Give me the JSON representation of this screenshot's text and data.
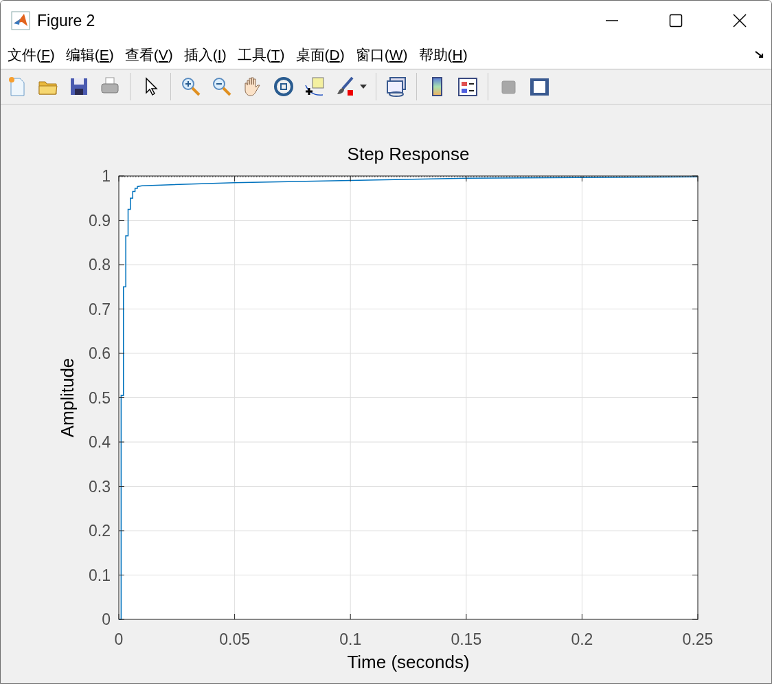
{
  "window": {
    "title": "Figure 2"
  },
  "menu": [
    {
      "before": "文件(",
      "key": "F",
      "after": ")"
    },
    {
      "before": "编辑(",
      "key": "E",
      "after": ")"
    },
    {
      "before": "查看(",
      "key": "V",
      "after": ")"
    },
    {
      "before": "插入(",
      "key": "I",
      "after": ")"
    },
    {
      "before": "工具(",
      "key": "T",
      "after": ")"
    },
    {
      "before": "桌面(",
      "key": "D",
      "after": ")"
    },
    {
      "before": "窗口(",
      "key": "W",
      "after": ")"
    },
    {
      "before": "帮助(",
      "key": "H",
      "after": ")"
    }
  ],
  "figure": {
    "chart_data": {
      "type": "line",
      "title": "Step Response",
      "xlabel": "Time (seconds)",
      "ylabel": "Amplitude",
      "xlim": [
        0,
        0.25
      ],
      "ylim": [
        0,
        1
      ],
      "xticks": [
        0,
        0.05,
        0.1,
        0.15,
        0.2,
        0.25
      ],
      "yticks": [
        0,
        0.1,
        0.2,
        0.3,
        0.4,
        0.5,
        0.6,
        0.7,
        0.8,
        0.9,
        1
      ],
      "grid": true,
      "x": [
        0,
        0.001,
        0.001,
        0.002,
        0.002,
        0.003,
        0.003,
        0.004,
        0.004,
        0.005,
        0.005,
        0.006,
        0.006,
        0.007,
        0.007,
        0.008,
        0.008,
        0.01,
        0.05,
        0.1,
        0.15,
        0.25
      ],
      "series": [
        {
          "color": "#0072bd",
          "values": [
            0,
            0,
            0.505,
            0.505,
            0.75,
            0.75,
            0.865,
            0.865,
            0.925,
            0.925,
            0.95,
            0.95,
            0.965,
            0.965,
            0.972,
            0.972,
            0.976,
            0.978,
            0.985,
            0.99,
            0.995,
            0.998
          ]
        }
      ]
    }
  }
}
